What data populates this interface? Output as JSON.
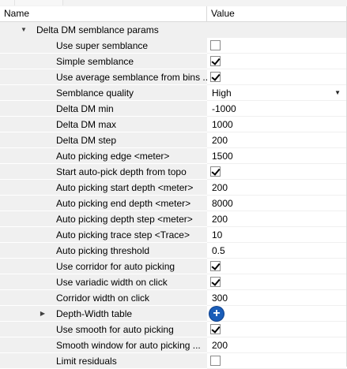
{
  "header": {
    "name_col": "Name",
    "value_col": "Value"
  },
  "group": {
    "label": "Delta DM semblance params"
  },
  "rows": [
    {
      "label": "Use super semblance",
      "kind": "checkbox",
      "checked": false
    },
    {
      "label": "Simple semblance",
      "kind": "checkbox",
      "checked": true
    },
    {
      "label": "Use average semblance from bins ...",
      "kind": "checkbox",
      "checked": true
    },
    {
      "label": "Semblance quality",
      "kind": "dropdown",
      "value": "High"
    },
    {
      "label": "Delta DM min",
      "kind": "text",
      "value": "-1000"
    },
    {
      "label": "Delta DM max",
      "kind": "text",
      "value": "1000"
    },
    {
      "label": "Delta DM step",
      "kind": "text",
      "value": "200"
    },
    {
      "label": "Auto picking edge <meter>",
      "kind": "text",
      "value": "1500"
    },
    {
      "label": "Start auto-pick depth from topo",
      "kind": "checkbox",
      "checked": true
    },
    {
      "label": "Auto picking start depth <meter>",
      "kind": "text",
      "value": "200"
    },
    {
      "label": "Auto picking end depth <meter>",
      "kind": "text",
      "value": "8000"
    },
    {
      "label": "Auto picking depth step <meter>",
      "kind": "text",
      "value": "200"
    },
    {
      "label": "Auto picking trace step <Trace>",
      "kind": "text",
      "value": "10"
    },
    {
      "label": "Auto picking threshold",
      "kind": "text",
      "value": "0.5"
    },
    {
      "label": "Use corridor for auto picking",
      "kind": "checkbox",
      "checked": true
    },
    {
      "label": "Use variadic width on click",
      "kind": "checkbox",
      "checked": true
    },
    {
      "label": "Corridor width on click",
      "kind": "text",
      "value": "300"
    },
    {
      "label": "Depth-Width table",
      "kind": "add",
      "expandable": true
    },
    {
      "label": "Use smooth for auto picking",
      "kind": "checkbox",
      "checked": true
    },
    {
      "label": "Smooth window for auto picking ...",
      "kind": "text",
      "value": "200"
    },
    {
      "label": "Limit residuals",
      "kind": "checkbox",
      "checked": false
    }
  ],
  "icons": {
    "group_expander": "triangle-down-icon",
    "row_expander": "triangle-right-icon",
    "dropdown": "chevron-down-icon",
    "add": "plus-circle-icon"
  },
  "colors": {
    "add_button": "#1a5db8",
    "grid_bg": "#f0f0f0"
  }
}
